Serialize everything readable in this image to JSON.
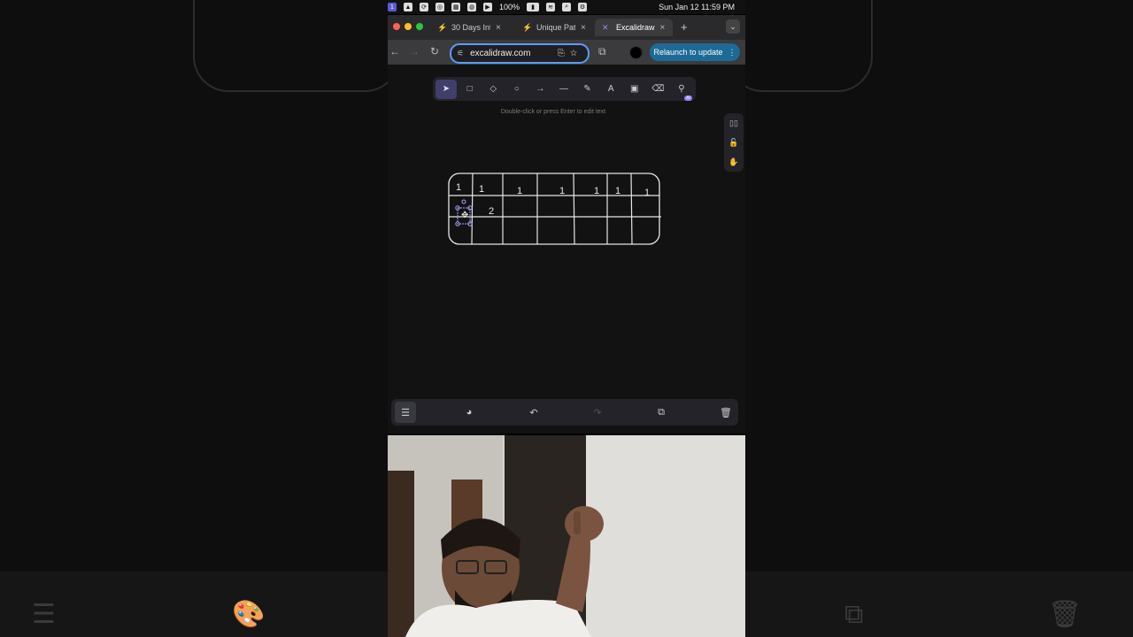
{
  "menubar": {
    "battery": "100%",
    "clock": "Sun Jan 12  11:59 PM"
  },
  "tabs": [
    {
      "label": "30 Days Int",
      "close": "×"
    },
    {
      "label": "Unique Path",
      "close": "×"
    },
    {
      "label": "Excalidraw",
      "close": "×",
      "active": true
    }
  ],
  "toolbar": {
    "url": "excalidraw.com",
    "relaunch_label": "Relaunch to update",
    "relaunch_menu": "⋮"
  },
  "canvas": {
    "hint": "Double-click or press Enter to edit text",
    "tools": [
      {
        "name": "selection",
        "glyph": "➤"
      },
      {
        "name": "rectangle",
        "glyph": "□"
      },
      {
        "name": "diamond",
        "glyph": "◇"
      },
      {
        "name": "ellipse",
        "glyph": "○"
      },
      {
        "name": "arrow",
        "glyph": "→"
      },
      {
        "name": "line",
        "glyph": "—"
      },
      {
        "name": "draw",
        "glyph": "✎"
      },
      {
        "name": "text",
        "glyph": "A"
      },
      {
        "name": "image",
        "glyph": "▣"
      },
      {
        "name": "eraser",
        "glyph": "⌫"
      },
      {
        "name": "more-tools",
        "glyph": "⚲",
        "badge": "AI"
      }
    ],
    "grid": {
      "row1": [
        "1",
        "1",
        "1",
        "1",
        "1",
        "1",
        "1"
      ],
      "row2": [
        "2"
      ]
    }
  },
  "colors": {
    "accent": "#403e6a",
    "relaunch": "#1d6a96",
    "canvas_bg": "#121212",
    "ink": "#e6e6e6"
  }
}
